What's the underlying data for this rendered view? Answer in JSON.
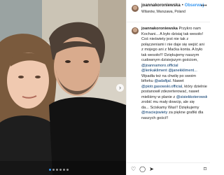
{
  "post": {
    "username": "joannakoroniewska",
    "separator": "•",
    "follow_label": "Obserwuj",
    "location": "Wilanów, Warszawa, Poland",
    "caption_lines": [
      [
        {
          "t": "joannakoroniewska",
          "k": "u"
        },
        {
          "t": " Przykro nam",
          "k": ""
        }
      ],
      [
        {
          "t": "Kochani... A było dzisiaj tak wesoło!",
          "k": ""
        }
      ],
      [
        {
          "t": "Coś nieświety jest nie tak z",
          "k": ""
        }
      ],
      [
        {
          "t": "połączeniami i nie daje się wejść ani",
          "k": ""
        }
      ],
      [
        {
          "t": "z mojego ani z Maćka konta. A było",
          "k": ""
        }
      ],
      [
        {
          "t": "tak wesoło!!! Dziękujemy naszym",
          "k": ""
        }
      ],
      [
        {
          "t": "cudownym dzisiejszym gościom,",
          "k": ""
        }
      ],
      [
        {
          "t": "@joannamoro.official",
          "k": "m"
        }
      ],
      [
        {
          "t": "@lenkakliment",
          "k": "m"
        },
        {
          "t": " ",
          "k": ""
        },
        {
          "t": "@janekkliment...",
          "k": "m"
        }
      ],
      [
        {
          "t": "Wpadła też na chwilę po swoim",
          "k": ""
        }
      ],
      [
        {
          "t": "biforku ",
          "k": ""
        },
        {
          "t": "@adafijal",
          "k": "m"
        },
        {
          "t": ". Nawet",
          "k": ""
        }
      ],
      [
        {
          "t": "@piotr.gasowski.official",
          "k": "m"
        },
        {
          "t": ", który dzielnie",
          "k": ""
        }
      ],
      [
        {
          "t": "postanowił zdezerterować, nawet",
          "k": ""
        }
      ],
      [
        {
          "t": "mieliśmy w planie z ",
          "k": ""
        },
        {
          "t": "@sisiekkoterowski",
          "k": "m"
        }
      ],
      [
        {
          "t": "zrobić mu mały dowcip, ale się",
          "k": ""
        }
      ],
      [
        {
          "t": "da... Ściskamy Was!! Dziękujemy",
          "k": ""
        }
      ],
      [
        {
          "t": "@maciejswiety",
          "k": "m"
        },
        {
          "t": " za piękne grafiki dla",
          "k": ""
        }
      ],
      [
        {
          "t": "naszych gości!!",
          "k": ""
        }
      ]
    ],
    "icons": {
      "more": "more-options-icon",
      "next": "chevron-right-icon",
      "like": "heart-icon",
      "comment": "comment-icon",
      "share": "share-icon",
      "save": "bookmark-icon"
    },
    "carousel": {
      "count": 6,
      "active_index": 0
    },
    "colors": {
      "accent": "#3897f0",
      "mention": "#003569",
      "border": "#efefef"
    }
  }
}
